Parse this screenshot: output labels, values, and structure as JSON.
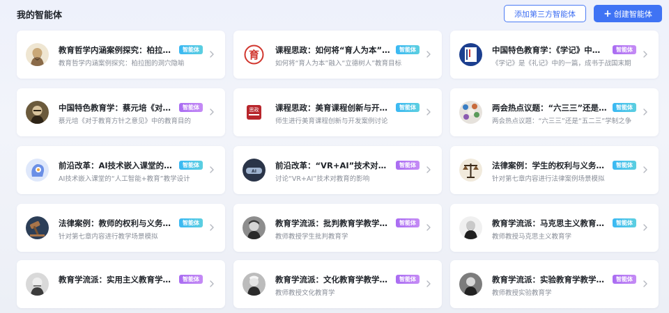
{
  "header": {
    "title": "我的智能体",
    "add_third_party_label": "添加第三方智能体",
    "create_label": "创建智能体"
  },
  "colors": {
    "accent": "#3f73f4",
    "badge_blue": "#3ab8f3",
    "badge_purple": "#a96cf2"
  },
  "agents": [
    {
      "title": "教育哲学内涵案例探究：柏拉图的洞穴隐喻",
      "badge": "智能体",
      "badge_color": "blue",
      "desc": "教育哲学内涵案例探究：柏拉图的洞穴隐喻",
      "icon": "plato-portrait-icon"
    },
    {
      "title": "课程思政：如何将“育人为本”融入“立德树人”",
      "badge": "智能体",
      "badge_color": "blue",
      "desc": "如何将“育人为本”融入“立德树人”教育目标",
      "icon": "yu-ren-seal-icon"
    },
    {
      "title": "中国特色教育学：《学记》中的教育思想",
      "badge": "智能体",
      "badge_color": "purple",
      "desc": "《学记》是《礼记》中的一篇，成书于战国末期",
      "icon": "xueji-book-icon"
    },
    {
      "title": "中国特色教育学：蔡元培《对于教育方针之意见》",
      "badge": "智能体",
      "badge_color": "purple",
      "desc": "蔡元培《对于教育方针之意见》中的教育目的",
      "icon": "cai-yuanpei-portrait-icon"
    },
    {
      "title": "课程思政：美育课程创新与开发案例讨论",
      "badge": "智能体",
      "badge_color": "blue",
      "desc": "师生进行美育课程创新与开发案例讨论",
      "icon": "sizheng-seal-icon"
    },
    {
      "title": "两会热点议题：“六三三”还是“五二三”",
      "badge": "智能体",
      "badge_color": "blue",
      "desc": "两会热点议题：“六三三”还是“五二三”学制之争",
      "icon": "conference-table-icon"
    },
    {
      "title": "前沿改革：AI技术嵌入课堂的“人工智能+教育”",
      "badge": "智能体",
      "badge_color": "blue",
      "desc": "AI技术嵌入课堂的“人工智能+教育”教学设计",
      "icon": "ai-head-icon"
    },
    {
      "title": "前沿改革：“VR+AI”技术对教育的影响",
      "badge": "智能体",
      "badge_color": "purple",
      "desc": "讨论“VR+AI”技术对教育的影响",
      "icon": "vr-ai-icon"
    },
    {
      "title": "法律案例：学生的权利与义务案例",
      "badge": "智能体",
      "badge_color": "blue",
      "desc": "针对第七章内容进行法律案例场景模拟",
      "icon": "scales-icon"
    },
    {
      "title": "法律案例：教师的权利与义务案例",
      "badge": "智能体",
      "badge_color": "blue",
      "desc": "针对第七章内容进行教学场景模拟",
      "icon": "gavel-icon"
    },
    {
      "title": "教育学流派：批判教育学教学助手",
      "badge": "智能体",
      "badge_color": "purple",
      "desc": "教师教授学生批判教育学",
      "icon": "critical-scholar-portrait-icon"
    },
    {
      "title": "教育学流派：马克思主义教育学教学助手",
      "badge": "智能体",
      "badge_color": "blue",
      "desc": "教师教授马克思主义教育学",
      "icon": "marxist-scholar-portrait-icon"
    },
    {
      "title": "教育学流派：实用主义教育学教学助手",
      "badge": "智能体",
      "badge_color": "purple",
      "desc": "",
      "icon": "dewey-portrait-icon"
    },
    {
      "title": "教育学流派：文化教育学教学助手",
      "badge": "智能体",
      "badge_color": "purple",
      "desc": "教师教授文化教育学",
      "icon": "culture-scholar-portrait-icon"
    },
    {
      "title": "教育学流派：实验教育学教学助手",
      "badge": "智能体",
      "badge_color": "purple",
      "desc": "教师教授实验教育学",
      "icon": "experimental-scholar-portrait-icon"
    }
  ]
}
